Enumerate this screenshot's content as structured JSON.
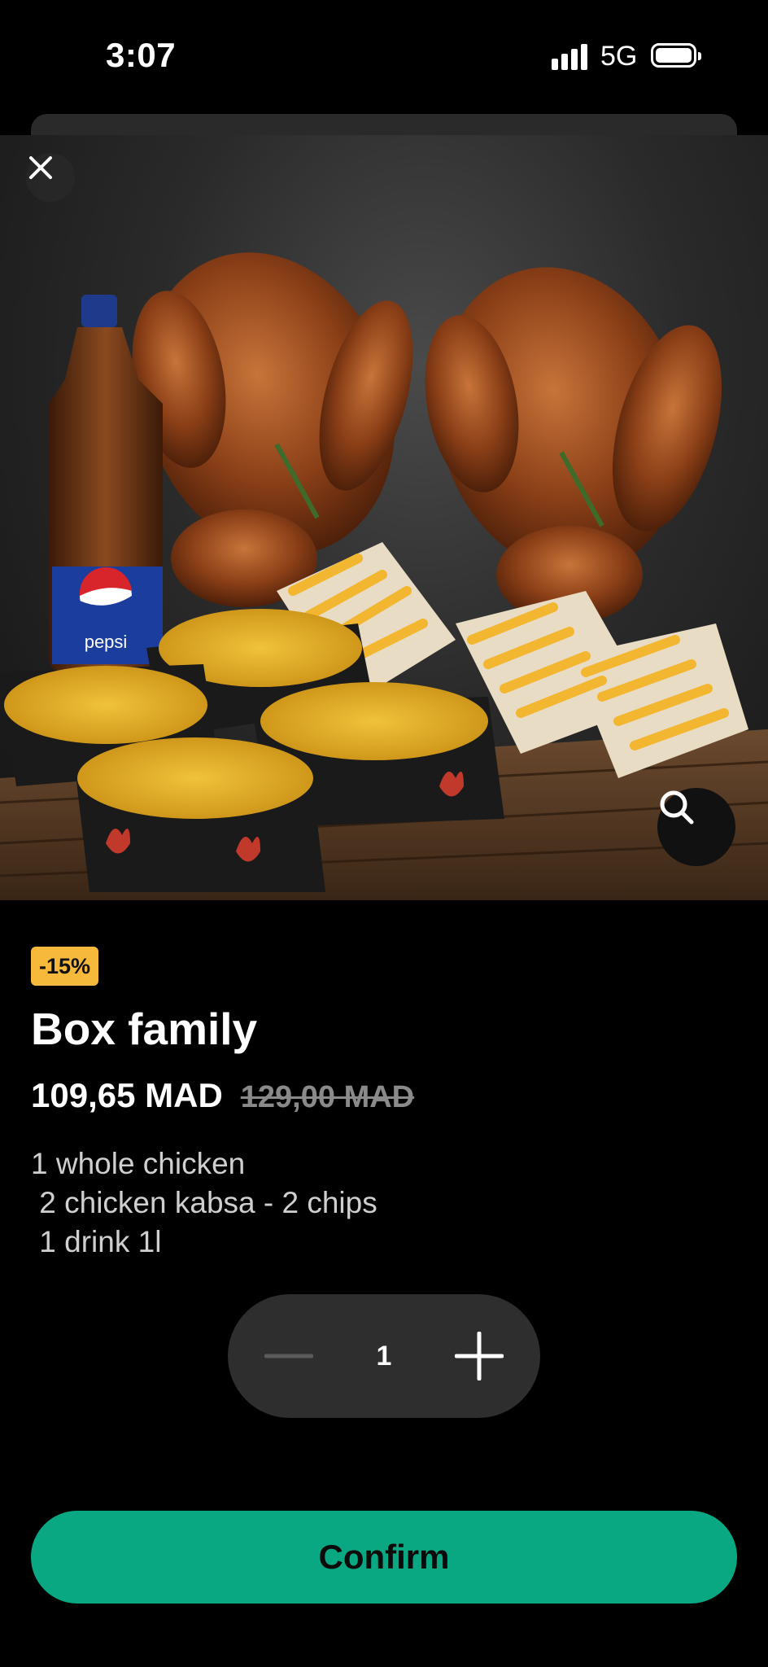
{
  "status_bar": {
    "time": "3:07",
    "network": "5G"
  },
  "hero": {
    "image_alt": "Box family meal",
    "close_icon": "close-icon",
    "zoom_icon": "search-icon",
    "bottle_text": "pepsi"
  },
  "product": {
    "discount": "-15%",
    "title": "Box family",
    "price": "109,65 MAD",
    "old_price": "129,00 MAD",
    "description_lines": [
      "1 whole chicken",
      " 2 chicken kabsa - 2 chips",
      " 1 drink 1l"
    ]
  },
  "quantity": {
    "value": "1",
    "minus_icon": "minus-icon",
    "plus_icon": "plus-icon"
  },
  "actions": {
    "confirm_label": "Confirm"
  },
  "colors": {
    "accent": "#0aa882",
    "badge": "#f6b93b",
    "background": "#000000"
  }
}
